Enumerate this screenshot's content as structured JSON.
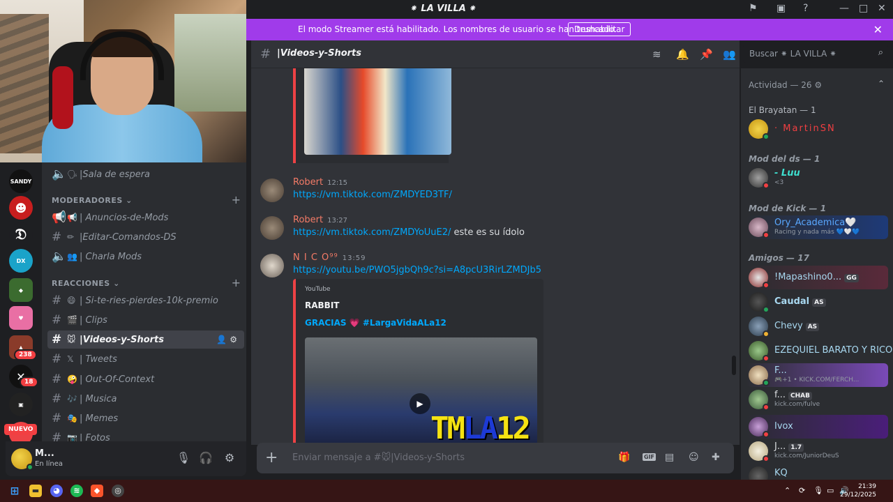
{
  "window": {
    "title": "⁕ LA VILLA ⁕"
  },
  "banner": {
    "text": "El modo Streamer está habilitado. Los nombres de usuario se han truncado.",
    "button": "Deshabilitar"
  },
  "servers": {
    "sandy_label": "SANDY",
    "badges": [
      "238",
      "18"
    ],
    "new_label": "NUEVO"
  },
  "channels": {
    "waiting_room": "|Sala de espera",
    "categories": [
      "MODERADORES",
      "REACCIONES"
    ],
    "mods": [
      "| Anuncios-de-Mods",
      "|Editar-Comandos-DS",
      "| Charla Mods"
    ],
    "reactions": [
      "| Si-te-ries-pierdes-10k-premio",
      "| Clips",
      "|Videos-y-Shorts",
      "| Tweets",
      "| Out-Of-Context",
      "| Musica",
      "| Memes",
      "| Fotos"
    ]
  },
  "user": {
    "name": "M...",
    "status": "En línea"
  },
  "chat": {
    "channel": "|Videos-y-Shorts",
    "search_placeholder": "Buscar ⁕ LA VILLA ⁕",
    "messages": [
      {
        "author": "Robert",
        "time": "12:15",
        "link": "https://vm.tiktok.com/ZMDYED3TF/",
        "text": ""
      },
      {
        "author": "Robert",
        "time": "13:27",
        "link": "https://vm.tiktok.com/ZMDYoUuE2/",
        "text": " este es su ídolo"
      },
      {
        "author": "N I C O⁹⁹",
        "time": "13:59",
        "link": "https://youtu.be/PWO5jgbQh9c?si=A8pcU3RirLZMDJb5",
        "text": ""
      }
    ],
    "embed": {
      "provider": "YouTube",
      "title": "RABBIT",
      "description": "GRACIAS 💗 #LargaVidaALa12",
      "thumb_text_a": "TM",
      "thumb_text_b": "LA",
      "thumb_text_c": "12"
    },
    "composer_placeholder": "Enviar mensaje a #🐭|Videos-y-Shorts"
  },
  "members": {
    "activity_header": "Actividad — 26",
    "groups": [
      {
        "label": "El Brayatan — 1"
      },
      {
        "label": "Mod del ds — 1"
      },
      {
        "label": "Mod de Kick — 1"
      },
      {
        "label": "Amigos — 17"
      }
    ],
    "list": [
      {
        "name": "· MartinSN",
        "sub": "",
        "tag": "",
        "color": "#f23f42"
      },
      {
        "name": "- Luu",
        "sub": "<3",
        "tag": "",
        "color": "#3ee0d0"
      },
      {
        "name": "Ory_Academica🤍",
        "sub": "Racing y nada más 💙🤍💙",
        "tag": "",
        "color": "#5aa8ff"
      },
      {
        "name": "!Mapashino0...",
        "sub": "",
        "tag": "GG",
        "color": "#dbdee1"
      },
      {
        "name": "Caudal",
        "sub": "",
        "tag": "AS",
        "color": "#a8d8f0"
      },
      {
        "name": "Chevy",
        "sub": "",
        "tag": "AS",
        "color": "#a8d8f0"
      },
      {
        "name": "EZEQUIEL BARATO Y RICO",
        "sub": "",
        "tag": "",
        "color": "#a8d8f0"
      },
      {
        "name": "F...",
        "sub": "🎮+1 • KICK.COM/FERCH...",
        "tag": "",
        "color": "#a8d8f0"
      },
      {
        "name": "f...",
        "sub": "kick.com/fulve",
        "tag": "CHAB",
        "color": "#dbdee1"
      },
      {
        "name": "Ivox",
        "sub": "",
        "tag": "",
        "color": "#a8d8f0"
      },
      {
        "name": "J...",
        "sub": "kick.com/JuniorDeuS",
        "tag": "1.7",
        "color": "#dbdee1"
      },
      {
        "name": "KQ",
        "sub": "",
        "tag": "",
        "color": "#a8d8f0"
      }
    ]
  },
  "taskbar": {
    "time": "21:39",
    "date": "29/12/2025"
  }
}
